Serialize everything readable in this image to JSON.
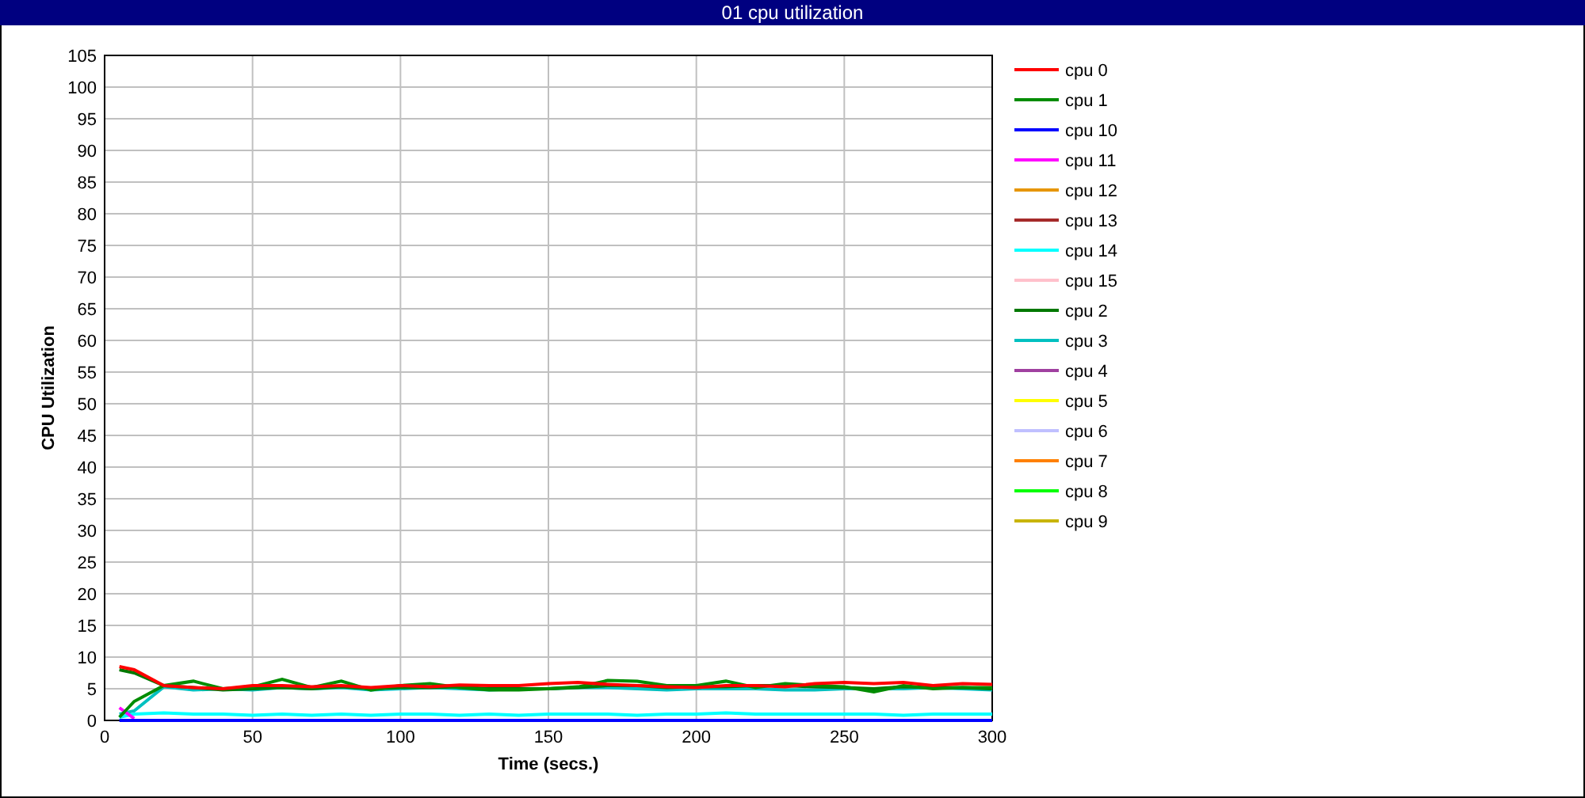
{
  "window": {
    "title": "01 cpu utilization"
  },
  "chart_data": {
    "type": "line",
    "grid": true,
    "legend": true,
    "xlabel": "Time (secs.)",
    "ylabel": "CPU Utilization",
    "xlim": [
      0,
      300
    ],
    "ylim": [
      0,
      105
    ],
    "xticks": [
      0,
      50,
      100,
      150,
      200,
      250,
      300
    ],
    "yticks": [
      0,
      5,
      10,
      15,
      20,
      25,
      30,
      35,
      40,
      45,
      50,
      55,
      60,
      65,
      70,
      75,
      80,
      85,
      90,
      95,
      100,
      105
    ],
    "x": [
      5,
      10,
      20,
      30,
      40,
      50,
      60,
      70,
      80,
      90,
      100,
      110,
      120,
      130,
      140,
      150,
      160,
      170,
      180,
      190,
      200,
      210,
      220,
      230,
      240,
      250,
      260,
      270,
      280,
      290,
      300
    ],
    "series": [
      {
        "name": "cpu 0",
        "color": "#ff0000",
        "values": [
          8.5,
          8,
          5.5,
          5.2,
          5,
          5.5,
          5.5,
          5.3,
          5.5,
          5.2,
          5.5,
          5.3,
          5.6,
          5.5,
          5.5,
          5.8,
          6,
          5.7,
          5.5,
          5.3,
          5.2,
          5.5,
          5.5,
          5.3,
          5.8,
          6,
          5.8,
          6,
          5.5,
          5.8,
          5.7
        ]
      },
      {
        "name": "cpu 1",
        "color": "#008c00",
        "values": [
          0.5,
          3,
          5.5,
          6.2,
          5,
          5.3,
          6.5,
          5.2,
          6.2,
          4.8,
          5.5,
          5.8,
          5.2,
          4.8,
          4.8,
          5,
          5.3,
          6.3,
          6.2,
          5.5,
          5.5,
          6.2,
          5.2,
          5.8,
          5.5,
          5.3,
          4.5,
          5.5,
          5,
          5.2,
          5.2
        ]
      },
      {
        "name": "cpu 10",
        "color": "#0000ff",
        "values": [
          0,
          0,
          0,
          0,
          0,
          0,
          0,
          0,
          0,
          0,
          0,
          0,
          0,
          0,
          0,
          0,
          0,
          0,
          0,
          0,
          0,
          0,
          0,
          0,
          0,
          0,
          0,
          0,
          0,
          0,
          0
        ]
      },
      {
        "name": "cpu 11",
        "color": "#ff00ff",
        "values": [
          2,
          0.3,
          null,
          null,
          null,
          null,
          null,
          null,
          null,
          null,
          null,
          null,
          null,
          null,
          null,
          null,
          null,
          null,
          null,
          null,
          null,
          null,
          null,
          null,
          null,
          null,
          null,
          null,
          null,
          null,
          null
        ]
      },
      {
        "name": "cpu 12",
        "color": "#e69500",
        "values": [
          null,
          null,
          null,
          null,
          null,
          null,
          null,
          null,
          null,
          null,
          null,
          null,
          null,
          null,
          null,
          null,
          null,
          null,
          null,
          null,
          null,
          null,
          null,
          null,
          null,
          null,
          null,
          null,
          null,
          null,
          null
        ]
      },
      {
        "name": "cpu 13",
        "color": "#a52a2a",
        "values": [
          null,
          null,
          null,
          null,
          null,
          null,
          null,
          null,
          null,
          null,
          null,
          null,
          null,
          null,
          null,
          null,
          null,
          null,
          null,
          null,
          null,
          null,
          null,
          null,
          null,
          null,
          null,
          null,
          null,
          null,
          null
        ]
      },
      {
        "name": "cpu 14",
        "color": "#00ffff",
        "values": [
          0.5,
          1,
          1.2,
          1,
          1,
          0.8,
          1,
          0.8,
          1,
          0.8,
          1,
          1,
          0.8,
          1,
          0.8,
          1,
          1,
          1,
          0.8,
          1,
          1,
          1.2,
          1,
          1,
          1,
          1,
          1,
          0.8,
          1,
          1,
          1
        ]
      },
      {
        "name": "cpu 15",
        "color": "#ffc0cb",
        "values": [
          null,
          null,
          null,
          null,
          null,
          null,
          null,
          null,
          null,
          null,
          null,
          null,
          null,
          null,
          null,
          null,
          null,
          null,
          null,
          null,
          null,
          null,
          null,
          null,
          null,
          null,
          null,
          null,
          null,
          null,
          null
        ]
      },
      {
        "name": "cpu 2",
        "color": "#007800",
        "values": [
          8,
          7.5,
          5.5,
          5.2,
          4.8,
          5,
          5.2,
          5,
          5.3,
          5,
          5.2,
          5.2,
          5.3,
          5,
          5,
          5,
          5.2,
          5.5,
          5.5,
          5.2,
          5.3,
          5.3,
          5.5,
          5.5,
          5.3,
          5.2,
          5,
          5.3,
          5.2,
          5.2,
          5
        ]
      },
      {
        "name": "cpu 3",
        "color": "#00c0c0",
        "values": [
          1,
          1.5,
          5.3,
          4.8,
          5,
          4.8,
          5.2,
          5,
          5.2,
          4.8,
          5,
          5.2,
          5,
          4.8,
          5,
          5,
          5.2,
          5.2,
          5,
          4.8,
          5,
          5,
          5,
          4.8,
          4.8,
          5,
          5,
          5,
          5.2,
          5,
          4.8
        ]
      },
      {
        "name": "cpu 4",
        "color": "#a040a0",
        "values": [
          null,
          null,
          null,
          null,
          null,
          null,
          null,
          null,
          null,
          null,
          null,
          null,
          null,
          null,
          null,
          null,
          null,
          null,
          null,
          null,
          null,
          null,
          null,
          null,
          null,
          null,
          null,
          null,
          null,
          null,
          null
        ]
      },
      {
        "name": "cpu 5",
        "color": "#ffff00",
        "values": [
          null,
          null,
          null,
          null,
          null,
          null,
          null,
          null,
          null,
          null,
          null,
          null,
          null,
          null,
          null,
          null,
          null,
          null,
          null,
          null,
          null,
          null,
          null,
          null,
          null,
          null,
          null,
          null,
          null,
          null,
          null
        ]
      },
      {
        "name": "cpu 6",
        "color": "#c0c0ff",
        "values": [
          null,
          null,
          null,
          null,
          null,
          null,
          null,
          null,
          null,
          null,
          null,
          null,
          null,
          null,
          null,
          null,
          null,
          null,
          null,
          null,
          null,
          null,
          null,
          null,
          null,
          null,
          null,
          null,
          null,
          null,
          null
        ]
      },
      {
        "name": "cpu 7",
        "color": "#ff8000",
        "values": [
          null,
          null,
          null,
          null,
          null,
          null,
          null,
          null,
          null,
          null,
          null,
          null,
          null,
          null,
          null,
          null,
          null,
          null,
          null,
          null,
          null,
          null,
          null,
          null,
          null,
          null,
          null,
          null,
          null,
          null,
          null
        ]
      },
      {
        "name": "cpu 8",
        "color": "#00ff00",
        "values": [
          null,
          null,
          null,
          null,
          null,
          null,
          null,
          null,
          null,
          null,
          null,
          null,
          null,
          null,
          null,
          null,
          null,
          null,
          null,
          null,
          null,
          null,
          null,
          null,
          null,
          null,
          null,
          null,
          null,
          null,
          null
        ]
      },
      {
        "name": "cpu 9",
        "color": "#c8b400",
        "values": [
          null,
          null,
          null,
          null,
          null,
          null,
          null,
          null,
          null,
          null,
          null,
          null,
          null,
          null,
          null,
          null,
          null,
          null,
          null,
          null,
          null,
          null,
          null,
          null,
          null,
          null,
          null,
          null,
          null,
          null,
          null
        ]
      }
    ]
  }
}
